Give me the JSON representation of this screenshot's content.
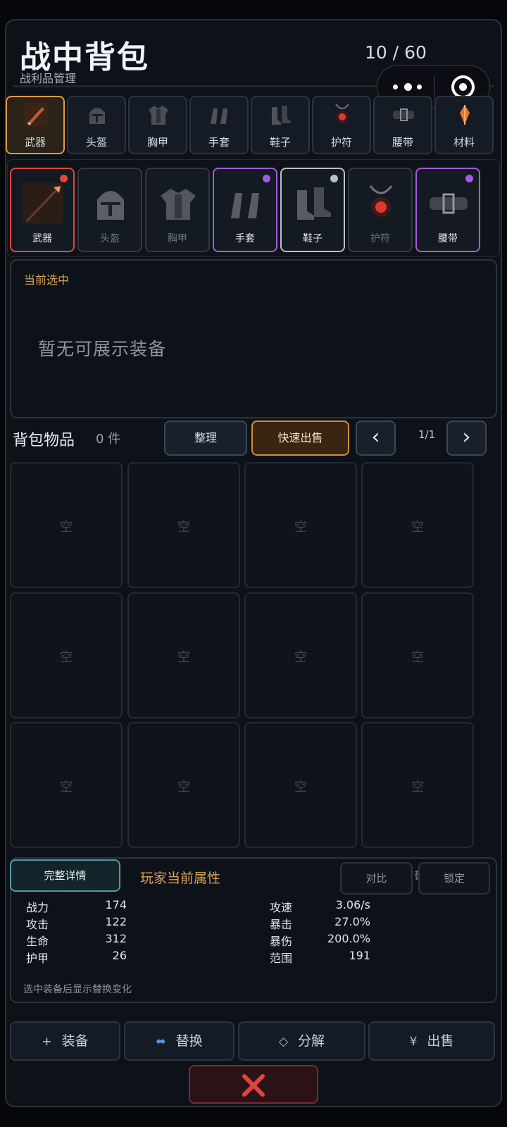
{
  "header": {
    "title": "战中背包",
    "subtitle": "战利品管理",
    "capacity": "10 / 60"
  },
  "category_tabs": [
    {
      "label": "武器",
      "icon": "sword-icon",
      "active": true
    },
    {
      "label": "头盔",
      "icon": "helmet-icon",
      "active": false
    },
    {
      "label": "胸甲",
      "icon": "chest-armor-icon",
      "active": false
    },
    {
      "label": "手套",
      "icon": "gloves-icon",
      "active": false
    },
    {
      "label": "鞋子",
      "icon": "boots-icon",
      "active": false
    },
    {
      "label": "护符",
      "icon": "amulet-icon",
      "active": false
    },
    {
      "label": "腰带",
      "icon": "belt-icon",
      "active": false
    },
    {
      "label": "材料",
      "icon": "crystal-icon",
      "active": false
    }
  ],
  "equipment_slots": [
    {
      "label": "武器",
      "icon": "spear-icon",
      "rarity_color": "#e0473f",
      "equipped": true
    },
    {
      "label": "头盔",
      "icon": "helmet-icon",
      "rarity_color": null,
      "equipped": false
    },
    {
      "label": "胸甲",
      "icon": "chest-armor-icon",
      "rarity_color": null,
      "equipped": false
    },
    {
      "label": "手套",
      "icon": "gloves-icon",
      "rarity_color": "#a55be0",
      "equipped": true
    },
    {
      "label": "鞋子",
      "icon": "boots-icon",
      "rarity_color": "#b9bfc8",
      "equipped": true
    },
    {
      "label": "护符",
      "icon": "amulet-icon",
      "rarity_color": null,
      "equipped": false
    },
    {
      "label": "腰带",
      "icon": "belt-icon",
      "rarity_color": "#a55be0",
      "equipped": true
    }
  ],
  "selection": {
    "label": "当前选中",
    "empty_text": "暂无可展示装备"
  },
  "bag": {
    "title": "背包物品",
    "count": "0 件",
    "sort_label": "整理",
    "quick_sell_label": "快速出售",
    "prev_label": "‹",
    "next_label": "›",
    "page": "1/1",
    "empty_cell_label": "空"
  },
  "stats": {
    "detail_label": "完整详情",
    "title": "玩家当前属性",
    "compare_label": "对比",
    "lock_label": "锁定",
    "clipped_glyph": "替",
    "left": [
      {
        "name": "战力",
        "value": "174"
      },
      {
        "name": "攻击",
        "value": "122"
      },
      {
        "name": "生命",
        "value": "312"
      },
      {
        "name": "护甲",
        "value": "26"
      }
    ],
    "right": [
      {
        "name": "攻速",
        "value": "3.06/s"
      },
      {
        "name": "暴击",
        "value": "27.0%"
      },
      {
        "name": "暴伤",
        "value": "200.0%"
      },
      {
        "name": "范围",
        "value": "191"
      }
    ],
    "note": "选中装备后显示替换变化"
  },
  "actions": {
    "equip": {
      "glyph": "+",
      "label": "装备"
    },
    "swap": {
      "glyph": "⬌",
      "label": "替换"
    },
    "dismantle": {
      "glyph": "◇",
      "label": "分解"
    },
    "sell": {
      "glyph": "¥",
      "label": "出售"
    },
    "close_icon": "close-x-icon"
  },
  "colors": {
    "accent_orange": "#e39a40",
    "rarity_red": "#e0473f",
    "rarity_purple": "#a55be0",
    "rarity_white": "#b9bfc8",
    "detail_teal": "#4f9aa3",
    "close_red": "#e0443c"
  }
}
